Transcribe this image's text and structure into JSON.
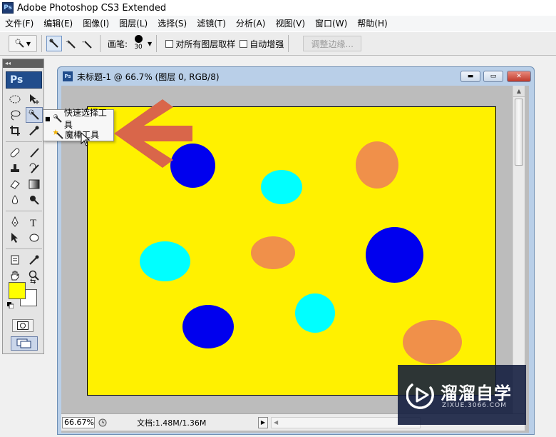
{
  "app": {
    "title": "Adobe Photoshop CS3 Extended",
    "logo": "Ps"
  },
  "menu": [
    {
      "label": "文件(F)"
    },
    {
      "label": "编辑(E)"
    },
    {
      "label": "图像(I)"
    },
    {
      "label": "图层(L)"
    },
    {
      "label": "选择(S)"
    },
    {
      "label": "滤镜(T)"
    },
    {
      "label": "分析(A)"
    },
    {
      "label": "视图(V)"
    },
    {
      "label": "窗口(W)"
    },
    {
      "label": "帮助(H)"
    }
  ],
  "options": {
    "brush_label": "画笔:",
    "brush_size": "30",
    "sample_all_layers": "对所有图层取样",
    "auto_enhance": "自动增强",
    "refine_edge": "调整边缘..."
  },
  "toolbox": {
    "logo": "Ps",
    "foreground_color": "#ffff00",
    "background_color": "#ffffff"
  },
  "flyout": {
    "items": [
      {
        "label": "快速选择工具",
        "selected": true,
        "icon": "quick-selection-icon"
      },
      {
        "label": "魔棒工具",
        "selected": false,
        "icon": "magic-wand-icon"
      }
    ]
  },
  "document": {
    "title": "未标题-1 @ 66.7% (图层 0, RGB/8)",
    "logo": "Ps",
    "canvas_color": "#fff100",
    "zoom": "66.67%",
    "doc_info": "文档:1.48M/1.36M"
  },
  "colors": {
    "blue": "#0000ee",
    "cyan": "#00ffff",
    "orange": "#f0904a",
    "annotation_arrow": "#d9664a"
  },
  "watermark": {
    "title": "溜溜自学",
    "url": "ZIXUE.3066.COM"
  }
}
